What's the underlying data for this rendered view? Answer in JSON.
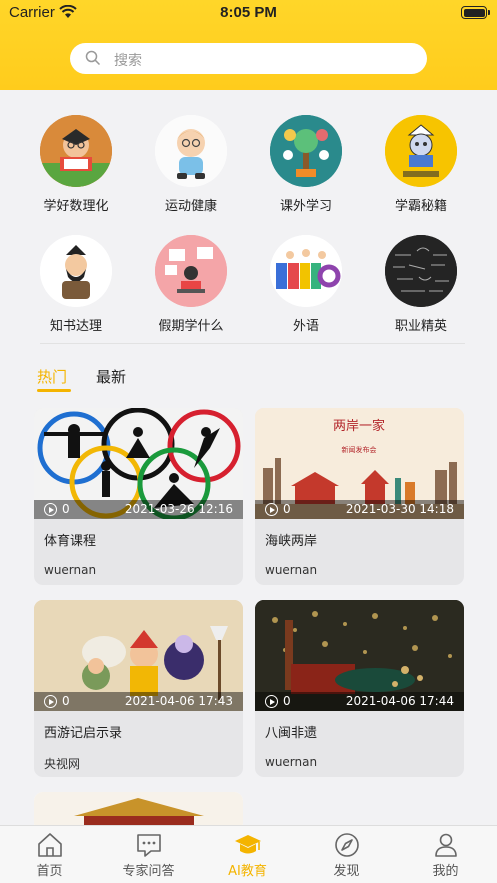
{
  "status": {
    "carrier": "Carrier",
    "time": "8:05 PM"
  },
  "search": {
    "placeholder": "搜索"
  },
  "categories": [
    {
      "label": "学好数理化",
      "icon": "reading-boy-icon"
    },
    {
      "label": "运动健康",
      "icon": "child-icon"
    },
    {
      "label": "课外学习",
      "icon": "learning-tree-icon"
    },
    {
      "label": "学霸秘籍",
      "icon": "scholar-icon"
    },
    {
      "label": "知书达理",
      "icon": "sage-icon"
    },
    {
      "label": "假期学什么",
      "icon": "laptop-icon"
    },
    {
      "label": "外语",
      "icon": "hello-icon"
    },
    {
      "label": "职业精英",
      "icon": "blackboard-icon"
    }
  ],
  "tabs": {
    "hot": "热门",
    "latest": "最新"
  },
  "cards": [
    {
      "title": "体育课程",
      "author": "wuernan",
      "views": "0",
      "time": "2021-03-26 12:16"
    },
    {
      "title": "海峡两岸",
      "author": "wuernan",
      "views": "0",
      "time": "2021-03-30 14:18"
    },
    {
      "title": "西游记启示录",
      "author": "央视网",
      "views": "0",
      "time": "2021-04-06 17:43"
    },
    {
      "title": "八闽非遗",
      "author": "wuernan",
      "views": "0",
      "time": "2021-04-06 17:44"
    }
  ],
  "thumb_text": {
    "cross_strait_title": "两岸一家",
    "cross_strait_sub": "新闻发布会"
  },
  "tabbar": [
    {
      "label": "首页",
      "icon": "home-icon"
    },
    {
      "label": "专家问答",
      "icon": "chat-icon"
    },
    {
      "label": "AI教育",
      "icon": "graduation-cap-icon"
    },
    {
      "label": "发现",
      "icon": "compass-icon"
    },
    {
      "label": "我的",
      "icon": "person-icon"
    }
  ],
  "colors": {
    "accent": "#f4b400",
    "header": "#ffd629"
  }
}
